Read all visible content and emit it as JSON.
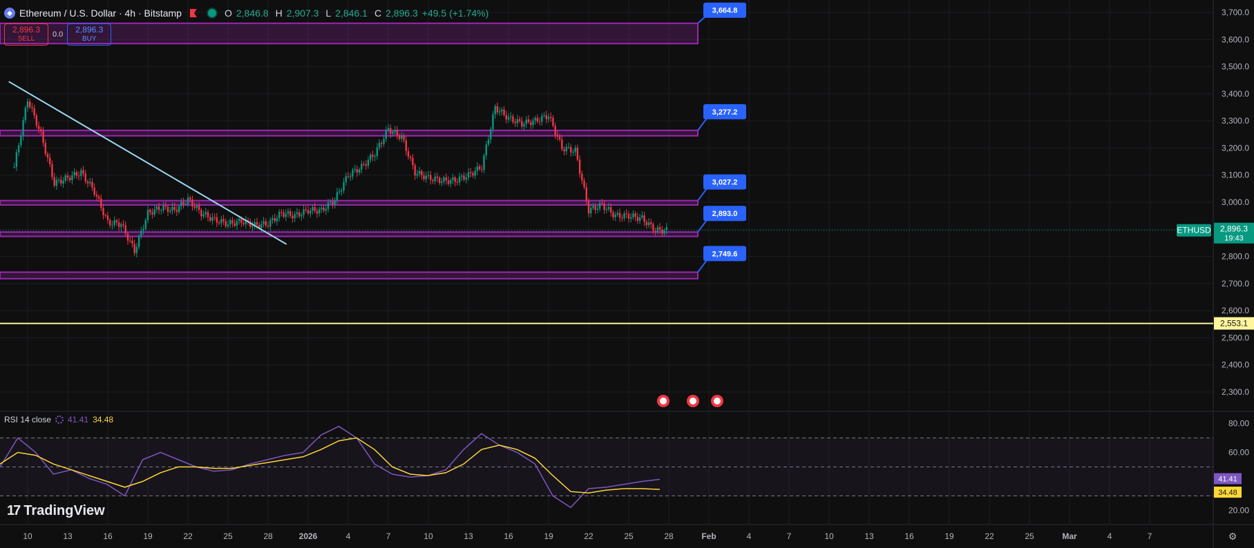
{
  "header": {
    "symbol_title": "Ethereum / U.S. Dollar · 4h · Bitstamp",
    "o_label": "O",
    "o_value": "2,846.8",
    "h_label": "H",
    "h_value": "2,907.3",
    "l_label": "L",
    "l_value": "2,846.1",
    "c_label": "C",
    "c_value": "2,896.3",
    "change": "+49.5 (+1.74%)"
  },
  "trade": {
    "sell_price": "2,896.3",
    "sell_label": "SELL",
    "spread": "0.0",
    "buy_price": "2,896.3",
    "buy_label": "BUY"
  },
  "rsi": {
    "label": "RSI 14 close",
    "value": "41.41",
    "ma_value": "34.48"
  },
  "watermark": "TradingView",
  "colors": {
    "bg": "#0f0f0f",
    "up": "#089981",
    "down": "#f23645",
    "zone": "#9c27b0",
    "tag": "#2962ff",
    "rsi": "#7e57c2",
    "rsi_ma": "#fdd835",
    "trend": "#9ad8f0"
  },
  "chart_data": {
    "type": "candlestick",
    "symbol": "ETHUSD",
    "timeframe": "4h",
    "y_ticks": [
      "3,700.0",
      "3,600.0",
      "3,500.0",
      "3,400.0",
      "3,300.0",
      "3,200.0",
      "3,100.0",
      "3,000.0",
      "2,900.0",
      "2,800.0",
      "2,700.0",
      "2,600.0",
      "2,500.0",
      "2,400.0",
      "2,300.0"
    ],
    "ylim": [
      2265,
      3725
    ],
    "x_ticks": [
      "10",
      "13",
      "16",
      "19",
      "22",
      "25",
      "28",
      "2026",
      "4",
      "7",
      "10",
      "13",
      "16",
      "19",
      "22",
      "25",
      "28",
      "Feb",
      "4",
      "7",
      "10",
      "13",
      "16",
      "19",
      "22",
      "25",
      "Mar",
      "4",
      "7"
    ],
    "last_price": "2,896.3",
    "countdown": "19:43",
    "symbol_badge": "ETHUSD",
    "horizontal_line": {
      "value": 2553.1,
      "label": "2,553.1"
    },
    "zones": [
      {
        "label": "3,664.8",
        "top": 3660,
        "bottom": 3585
      },
      {
        "label": "3,277.2",
        "top": 3265,
        "bottom": 3245
      },
      {
        "label": "3,027.2",
        "top": 3006,
        "bottom": 2990
      },
      {
        "label": "2,893.0",
        "top": 2890,
        "bottom": 2874
      },
      {
        "label": "2,749.6",
        "top": 2742,
        "bottom": 2718
      }
    ],
    "trendline": {
      "from": [
        "Dec 9",
        3445
      ],
      "to": [
        "Dec 30",
        2845
      ]
    },
    "series": [
      {
        "name": "ETHUSD",
        "points": [
          [
            "Dec 9",
            3130
          ],
          [
            "Dec 10",
            3380
          ],
          [
            "Dec 11",
            3250
          ],
          [
            "Dec 12",
            3070
          ],
          [
            "Dec 13",
            3090
          ],
          [
            "Dec 14",
            3110
          ],
          [
            "Dec 15",
            3040
          ],
          [
            "Dec 16",
            2925
          ],
          [
            "Dec 17",
            2920
          ],
          [
            "Dec 18",
            2820
          ],
          [
            "Dec 19",
            2960
          ],
          [
            "Dec 20",
            2980
          ],
          [
            "Dec 21",
            2970
          ],
          [
            "Dec 22",
            3010
          ],
          [
            "Dec 23",
            2960
          ],
          [
            "Dec 24",
            2935
          ],
          [
            "Dec 25",
            2920
          ],
          [
            "Dec 26",
            2930
          ],
          [
            "Dec 27",
            2915
          ],
          [
            "Dec 28",
            2920
          ],
          [
            "Dec 29",
            2960
          ],
          [
            "Dec 30",
            2950
          ],
          [
            "Dec 31",
            2970
          ],
          [
            "Jan 1",
            2970
          ],
          [
            "Jan 2",
            3010
          ],
          [
            "Jan 3",
            3100
          ],
          [
            "Jan 4",
            3130
          ],
          [
            "Jan 5",
            3180
          ],
          [
            "Jan 6",
            3270
          ],
          [
            "Jan 7",
            3240
          ],
          [
            "Jan 8",
            3110
          ],
          [
            "Jan 9",
            3090
          ],
          [
            "Jan 10",
            3080
          ],
          [
            "Jan 11",
            3080
          ],
          [
            "Jan 12",
            3100
          ],
          [
            "Jan 13",
            3130
          ],
          [
            "Jan 14",
            3350
          ],
          [
            "Jan 15",
            3310
          ],
          [
            "Jan 16",
            3290
          ],
          [
            "Jan 17",
            3300
          ],
          [
            "Jan 18",
            3320
          ],
          [
            "Jan 19",
            3200
          ],
          [
            "Jan 20",
            3190
          ],
          [
            "Jan 21",
            2970
          ],
          [
            "Jan 22",
            2990
          ],
          [
            "Jan 23",
            2950
          ],
          [
            "Jan 24",
            2950
          ],
          [
            "Jan 25",
            2940
          ],
          [
            "Jan 26",
            2896.3
          ]
        ]
      },
      {
        "name": "RSI",
        "ylim": [
          15,
          85
        ],
        "ticks": [
          "80.00",
          "60.00",
          "20.00"
        ],
        "levels": [
          70,
          50,
          30
        ],
        "points": [
          [
            0,
            50
          ],
          [
            1,
            70
          ],
          [
            2,
            60
          ],
          [
            3,
            45
          ],
          [
            4,
            48
          ],
          [
            5,
            42
          ],
          [
            6,
            38
          ],
          [
            7,
            30
          ],
          [
            8,
            55
          ],
          [
            9,
            60
          ],
          [
            10,
            55
          ],
          [
            11,
            50
          ],
          [
            12,
            47
          ],
          [
            13,
            48
          ],
          [
            14,
            52
          ],
          [
            15,
            55
          ],
          [
            16,
            58
          ],
          [
            17,
            60
          ],
          [
            18,
            72
          ],
          [
            19,
            78
          ],
          [
            20,
            70
          ],
          [
            21,
            52
          ],
          [
            22,
            45
          ],
          [
            23,
            43
          ],
          [
            24,
            44
          ],
          [
            25,
            48
          ],
          [
            26,
            62
          ],
          [
            27,
            73
          ],
          [
            28,
            65
          ],
          [
            29,
            60
          ],
          [
            30,
            52
          ],
          [
            31,
            30
          ],
          [
            32,
            22
          ],
          [
            33,
            35
          ],
          [
            34,
            36
          ],
          [
            35,
            38
          ],
          [
            36,
            40
          ],
          [
            37,
            41.41
          ]
        ]
      },
      {
        "name": "RSI MA",
        "points": [
          [
            0,
            52
          ],
          [
            1,
            60
          ],
          [
            2,
            58
          ],
          [
            3,
            52
          ],
          [
            4,
            48
          ],
          [
            5,
            44
          ],
          [
            6,
            40
          ],
          [
            7,
            36
          ],
          [
            8,
            40
          ],
          [
            9,
            46
          ],
          [
            10,
            50
          ],
          [
            11,
            50
          ],
          [
            12,
            49
          ],
          [
            13,
            49
          ],
          [
            14,
            51
          ],
          [
            15,
            53
          ],
          [
            16,
            55
          ],
          [
            17,
            57
          ],
          [
            18,
            62
          ],
          [
            19,
            68
          ],
          [
            20,
            70
          ],
          [
            21,
            62
          ],
          [
            22,
            50
          ],
          [
            23,
            45
          ],
          [
            24,
            44
          ],
          [
            25,
            46
          ],
          [
            26,
            52
          ],
          [
            27,
            62
          ],
          [
            28,
            65
          ],
          [
            29,
            62
          ],
          [
            30,
            56
          ],
          [
            31,
            44
          ],
          [
            32,
            33
          ],
          [
            33,
            32
          ],
          [
            34,
            34
          ],
          [
            35,
            35
          ],
          [
            36,
            35
          ],
          [
            37,
            34.48
          ]
        ]
      }
    ]
  }
}
